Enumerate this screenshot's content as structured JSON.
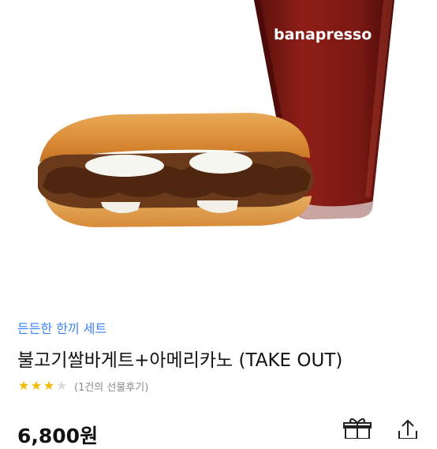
{
  "hero": {
    "image": "bulgogi-rice-baguette-and-americano",
    "brand_logo": "banapresso"
  },
  "product": {
    "category": "든든한 한끼 세트",
    "title": "불고기쌀바게트+아메리카노 (TAKE OUT)",
    "rating": 3,
    "rating_max": 4,
    "review_text": "(1건의 선물후기)",
    "price": "6,800원"
  },
  "actions": {
    "gift_icon": "gift-icon",
    "share_icon": "share-icon"
  },
  "colors": {
    "category": "#3b82f6",
    "star": "#f5b800",
    "star_empty": "#d9d9d9"
  }
}
